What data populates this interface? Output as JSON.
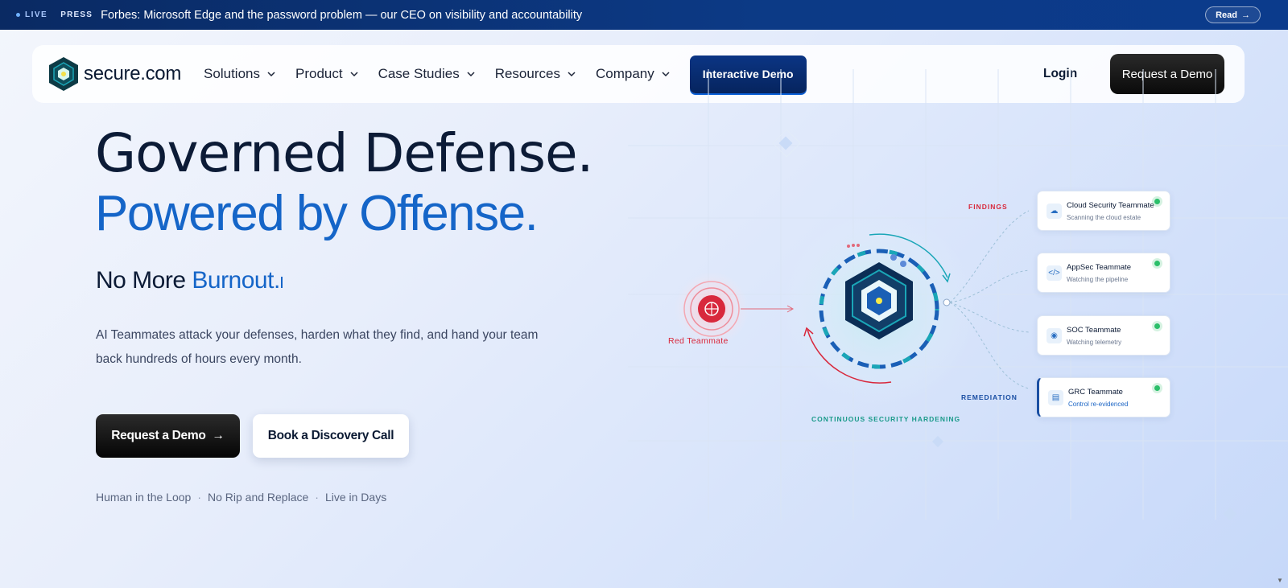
{
  "press_bar": {
    "live": "LIVE",
    "tag": "PRESS",
    "headline": "Forbes: Microsoft Edge and the password problem — our CEO on visibility and accountability",
    "read": "Read",
    "read_icon": "arrow-right-icon"
  },
  "nav": {
    "logo_text": "secure.com",
    "items": [
      {
        "label": "Solutions"
      },
      {
        "label": "Product"
      },
      {
        "label": "Case Studies"
      },
      {
        "label": "Resources"
      },
      {
        "label": "Company"
      }
    ],
    "interactive_demo": "Interactive Demo",
    "login": "Login",
    "request_demo": "Request a Demo"
  },
  "hero": {
    "line1": "Governed Defense.",
    "line2": "Powered by Offense.",
    "sub_prefix": "No More ",
    "sub_accent": "Burnout.",
    "description": "AI Teammates attack your defenses, harden what they find, and hand your team back hundreds of hours every month.",
    "cta_primary": "Request a Demo",
    "cta_secondary": "Book a Discovery Call",
    "tags": [
      "Human in the Loop",
      "No Rip and Replace",
      "Live in Days"
    ],
    "tag_separator": "·"
  },
  "diagram": {
    "red_teammate": "Red Teammate",
    "findings": "FINDINGS",
    "remediation": "REMEDIATION",
    "hardening": "CONTINUOUS SECURITY HARDENING",
    "cards": [
      {
        "title": "Cloud Security Teammate",
        "status": "Scanning the cloud estate",
        "icon": "cloud-icon"
      },
      {
        "title": "AppSec Teammate",
        "status": "Watching the pipeline",
        "icon": "code-icon"
      },
      {
        "title": "SOC Teammate",
        "status": "Watching telemetry",
        "icon": "radar-icon"
      },
      {
        "title": "GRC Teammate",
        "status": "Control re-evidenced",
        "icon": "document-icon"
      }
    ],
    "colors": {
      "red": "#d8283c",
      "blue": "#1565c8",
      "teal": "#1aa6b7",
      "green": "#2cbf6a"
    }
  }
}
